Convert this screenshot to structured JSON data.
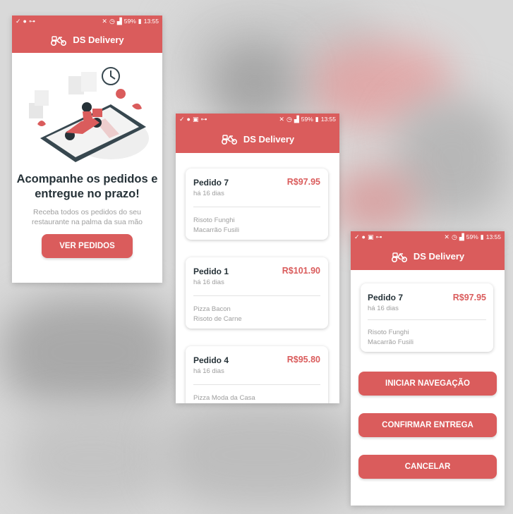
{
  "colors": {
    "primary": "#da5c5c",
    "text_dark": "#263238",
    "text_muted": "#9e9e9e",
    "card_bg": "#ffffff"
  },
  "status_bar": {
    "battery": "59%",
    "time": "13:55",
    "icons": [
      "check-icon",
      "notification-icon",
      "image-icon",
      "wifi-icon",
      "mute-icon",
      "alarm-icon",
      "signal-icon",
      "battery-icon"
    ]
  },
  "app": {
    "title": "DS Delivery",
    "logo_icon": "scooter-icon"
  },
  "home": {
    "illustration": "delivery-scooter-illustration",
    "title_line1": "Acompanhe os pedidos e",
    "title_line2": "entregue no prazo!",
    "subtitle": "Receba todos os pedidos do seu restaurante na palma da sua mão",
    "cta_label": "VER PEDIDOS"
  },
  "orders": [
    {
      "name": "Pedido 7",
      "price": "R$97.95",
      "time": "há 16 dias",
      "items": [
        "Risoto Funghi",
        "Macarrão Fusili"
      ]
    },
    {
      "name": "Pedido 1",
      "price": "R$101.90",
      "time": "há 16 dias",
      "items": [
        "Pizza Bacon",
        "Risoto de Carne"
      ]
    },
    {
      "name": "Pedido 4",
      "price": "R$95.80",
      "time": "há 16 dias",
      "items": [
        "Pizza Moda da Casa"
      ]
    }
  ],
  "detail": {
    "order": {
      "name": "Pedido 7",
      "price": "R$97.95",
      "time": "há 16 dias",
      "items": [
        "Risoto Funghi",
        "Macarrão Fusili"
      ]
    },
    "buttons": {
      "navigate": "INICIAR NAVEGAÇÃO",
      "confirm": "CONFIRMAR ENTREGA",
      "cancel": "CANCELAR"
    }
  }
}
